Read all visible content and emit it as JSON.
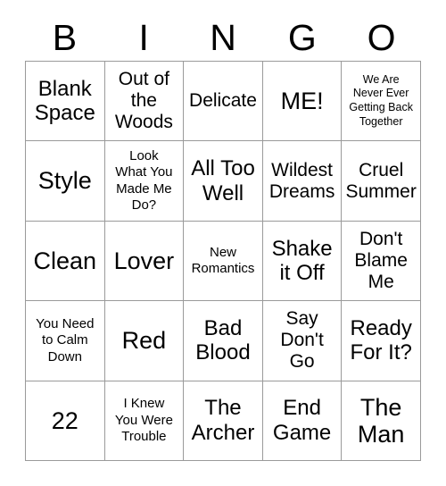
{
  "card": {
    "title": "BINGO",
    "header_letters": [
      "B",
      "I",
      "N",
      "G",
      "O"
    ],
    "grid_size": "5x5",
    "border_color": "#9a9a9a",
    "text_color": "#000000",
    "background_color": "#ffffff",
    "rows": [
      [
        {
          "text": "Blank\nSpace",
          "size": "lg"
        },
        {
          "text": "Out of\nthe\nWoods",
          "size": "md"
        },
        {
          "text": "Delicate",
          "size": "md"
        },
        {
          "text": "ME!",
          "size": "xl"
        },
        {
          "text": "We Are\nNever Ever\nGetting Back\nTogether",
          "size": "xs"
        }
      ],
      [
        {
          "text": "Style",
          "size": "xl"
        },
        {
          "text": "Look\nWhat You\nMade Me\nDo?",
          "size": "sm"
        },
        {
          "text": "All Too\nWell",
          "size": "lg"
        },
        {
          "text": "Wildest\nDreams",
          "size": "md"
        },
        {
          "text": "Cruel\nSummer",
          "size": "md"
        }
      ],
      [
        {
          "text": "Clean",
          "size": "xl"
        },
        {
          "text": "Lover",
          "size": "xl"
        },
        {
          "text": "New\nRomantics",
          "size": "sm"
        },
        {
          "text": "Shake\nit Off",
          "size": "lg"
        },
        {
          "text": "Don't\nBlame\nMe",
          "size": "md"
        }
      ],
      [
        {
          "text": "You Need\nto Calm\nDown",
          "size": "sm"
        },
        {
          "text": "Red",
          "size": "xl"
        },
        {
          "text": "Bad\nBlood",
          "size": "lg"
        },
        {
          "text": "Say\nDon't\nGo",
          "size": "md"
        },
        {
          "text": "Ready\nFor It?",
          "size": "lg"
        }
      ],
      [
        {
          "text": "22",
          "size": "xl"
        },
        {
          "text": "I Knew\nYou Were\nTrouble",
          "size": "sm"
        },
        {
          "text": "The\nArcher",
          "size": "lg"
        },
        {
          "text": "End\nGame",
          "size": "lg"
        },
        {
          "text": "The\nMan",
          "size": "xl"
        }
      ]
    ]
  }
}
